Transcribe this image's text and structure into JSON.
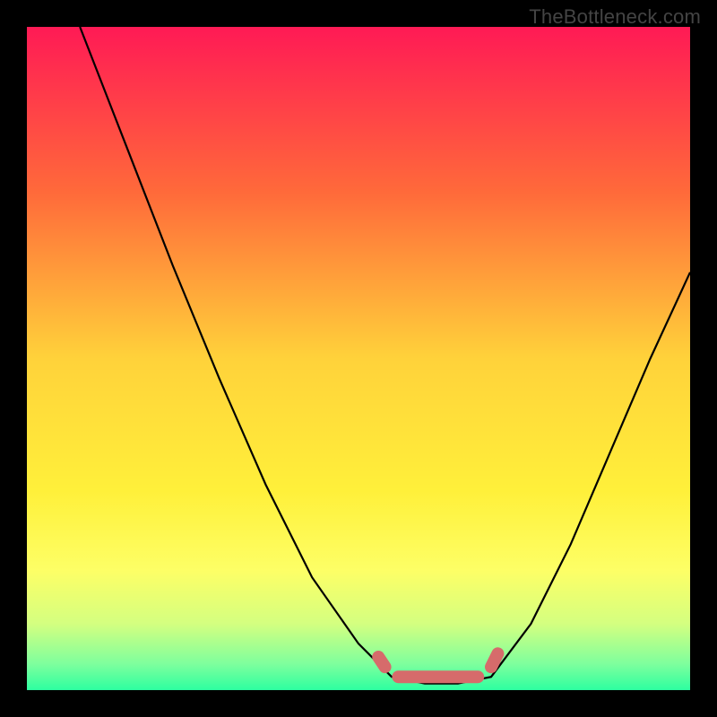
{
  "watermark": "TheBottleneck.com",
  "chart_data": {
    "type": "line",
    "title": "",
    "xlabel": "",
    "ylabel": "",
    "xlim": [
      0,
      100
    ],
    "ylim": [
      0,
      100
    ],
    "grid": false,
    "legend": false,
    "series": [
      {
        "name": "left-curve",
        "x": [
          8,
          15,
          22,
          29,
          36,
          43,
          50,
          55
        ],
        "values": [
          100,
          82,
          64,
          47,
          31,
          17,
          7,
          2
        ]
      },
      {
        "name": "valley",
        "x": [
          55,
          60,
          65,
          70
        ],
        "values": [
          2,
          1,
          1,
          2
        ]
      },
      {
        "name": "right-curve",
        "x": [
          70,
          76,
          82,
          88,
          94,
          100
        ],
        "values": [
          2,
          10,
          22,
          36,
          50,
          63
        ]
      }
    ],
    "annotations": [
      {
        "name": "marker-segment",
        "x": [
          53,
          71
        ],
        "y": [
          3,
          3
        ]
      }
    ],
    "gradient_stops": [
      {
        "offset": 0.0,
        "color": "#ff1a55"
      },
      {
        "offset": 0.25,
        "color": "#ff6a3a"
      },
      {
        "offset": 0.5,
        "color": "#ffd23a"
      },
      {
        "offset": 0.7,
        "color": "#fff03a"
      },
      {
        "offset": 0.82,
        "color": "#fdff66"
      },
      {
        "offset": 0.9,
        "color": "#d4ff80"
      },
      {
        "offset": 0.96,
        "color": "#7fff9d"
      },
      {
        "offset": 1.0,
        "color": "#2dffa0"
      }
    ]
  }
}
